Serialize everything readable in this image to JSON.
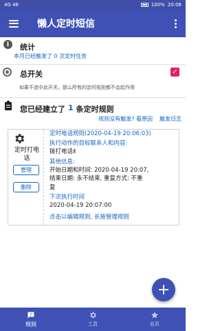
{
  "status_bar": {
    "left_text": "4G 46",
    "battery": "100%",
    "time": "20:06"
  },
  "app": {
    "title": "懒人定时短信",
    "menu_icon": "hamburger-menu-icon",
    "overflow_icon": "more-vert-icon"
  },
  "stats": {
    "label": "统计",
    "summary": "本月已经触发了 0 次定时任务"
  },
  "master_switch": {
    "label": "总开关",
    "checked": true,
    "description": "如果不选中此开关，那么所有的定时规则都不会起作用"
  },
  "rules_header": {
    "prefix": "您已经建立了",
    "count": "1",
    "suffix": "条定时规则",
    "link_why": "规则没有触发? 看原因",
    "link_log": "触发日志"
  },
  "rule": {
    "type_label": "定时打电话",
    "manage_label": "管理",
    "delete_label": "删除",
    "title": "定时电话规则(2020-04-19 20:06:03)",
    "action_label": "执行动作的目标联系人和内容:",
    "action_value": "拨打电话纟",
    "other_label": "其他信息:",
    "start_line": "开始日期和时间: 2020-04-19 20:07,",
    "end_line": "结束日期: 永不结束, 重复方式: 不重",
    "end_line2": "复",
    "next_label": "下次执行时间",
    "next_value": "2020-04-19 20:07:00",
    "hint": "点击以编辑规则, 长按管理规则"
  },
  "fab": {
    "label": "+"
  },
  "bottom_nav": {
    "items": [
      {
        "label": "规则",
        "icon": "rules-feedback-icon",
        "active": true
      },
      {
        "label": "工具",
        "icon": "gear-icon",
        "active": false
      },
      {
        "label": "会员",
        "icon": "star-icon",
        "active": false
      }
    ]
  },
  "colors": {
    "primary": "#3f51b5",
    "accent": "#e91e63",
    "link": "#1565c0"
  }
}
